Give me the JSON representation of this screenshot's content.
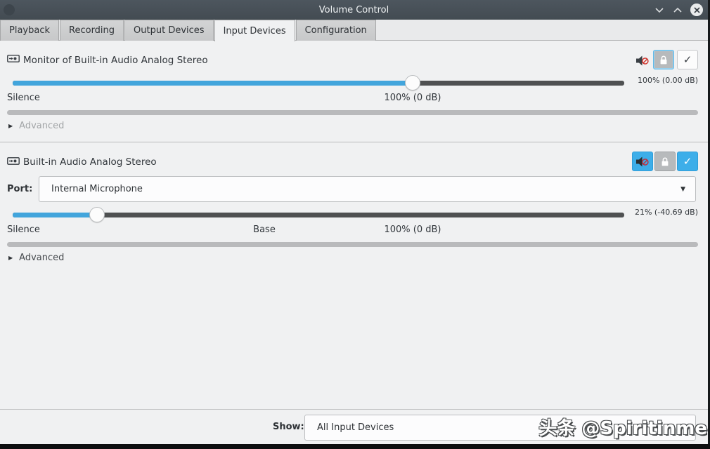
{
  "window": {
    "title": "Volume Control",
    "controls": {
      "minimize": "minimize",
      "maximize": "maximize",
      "close": "close"
    }
  },
  "tabs": [
    {
      "label": "Playback",
      "active": false
    },
    {
      "label": "Recording",
      "active": false
    },
    {
      "label": "Output Devices",
      "active": false
    },
    {
      "label": "Input Devices",
      "active": true
    },
    {
      "label": "Configuration",
      "active": false
    }
  ],
  "devices": [
    {
      "name": "Monitor of Built-in Audio Analog Stereo",
      "volume_label": "100% (0.00 dB)",
      "slider_percent": 65.4,
      "marks": {
        "left": "Silence",
        "hundred": "100% (0 dB)"
      },
      "advanced_label": "Advanced",
      "muted": true
    },
    {
      "name": "Built-in Audio Analog Stereo",
      "port_label": "Port:",
      "port_value": "Internal Microphone",
      "volume_label": "21% (-40.69 dB)",
      "slider_percent": 13.8,
      "marks": {
        "left": "Silence",
        "base": "Base",
        "hundred": "100% (0 dB)"
      },
      "advanced_label": "Advanced",
      "muted": true
    }
  ],
  "footer": {
    "show_label": "Show:",
    "show_value": "All Input Devices"
  },
  "watermark": "头条 @Spiritinme",
  "colors": {
    "accent_blue": "#3daee9",
    "slider_blue": "#42a5dc",
    "titlebar": "#49525a",
    "content_bg": "#f0f1f2",
    "mute_badge_red": "#d0342c"
  }
}
